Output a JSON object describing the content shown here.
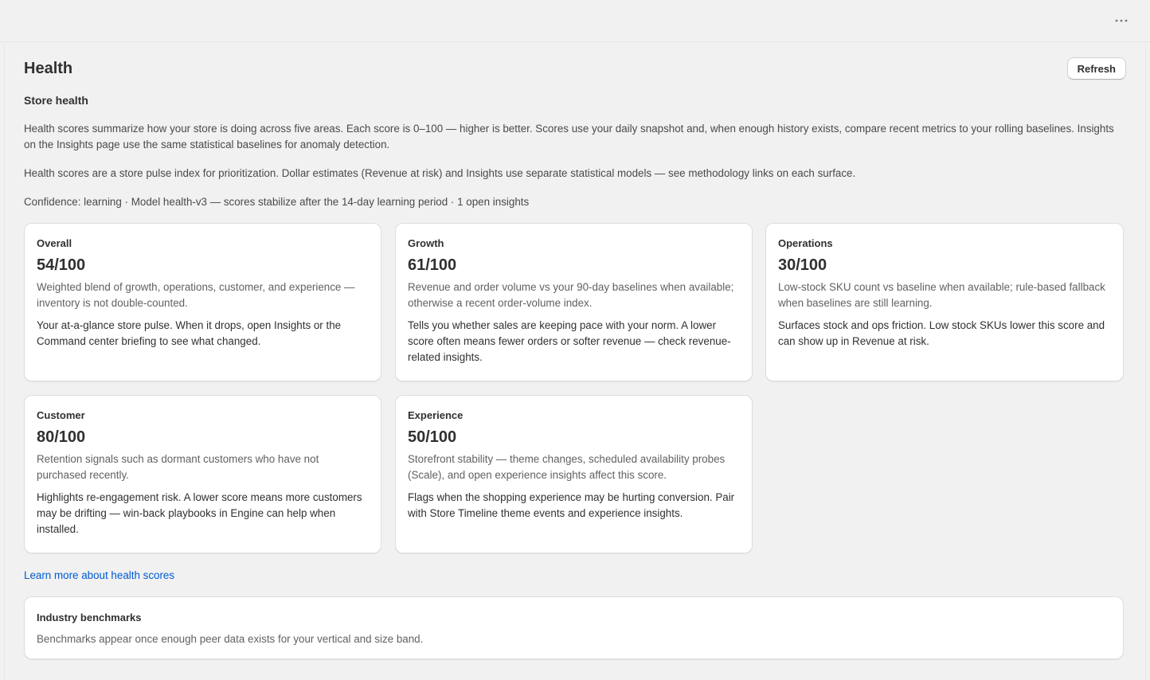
{
  "header": {
    "more_icon": "more-horizontal-icon"
  },
  "page": {
    "title": "Health",
    "refresh_label": "Refresh",
    "section_title": "Store health",
    "intro_1": "Health scores summarize how your store is doing across five areas. Each score is 0–100 — higher is better. Scores use your daily snapshot and, when enough history exists, compare recent metrics to your rolling baselines. Insights on the Insights page use the same statistical baselines for anomaly detection.",
    "intro_2": "Health scores are a store pulse index for prioritization. Dollar estimates (Revenue at risk) and Insights use separate statistical models — see methodology links on each surface.",
    "confidence_line": "Confidence: learning · Model health-v3 — scores stabilize after the 14-day learning period · 1 open insights"
  },
  "cards": [
    {
      "label": "Overall",
      "score": "54/100",
      "score_value": 54,
      "description": "Weighted blend of growth, operations, customer, and experience — inventory is not double-counted.",
      "note": "Your at-a-glance store pulse. When it drops, open Insights or the Command center briefing to see what changed."
    },
    {
      "label": "Growth",
      "score": "61/100",
      "score_value": 61,
      "description": "Revenue and order volume vs your 90-day baselines when available; otherwise a recent order-volume index.",
      "note": "Tells you whether sales are keeping pace with your norm. A lower score often means fewer orders or softer revenue — check revenue-related insights."
    },
    {
      "label": "Operations",
      "score": "30/100",
      "score_value": 30,
      "description": "Low-stock SKU count vs baseline when available; rule-based fallback when baselines are still learning.",
      "note": "Surfaces stock and ops friction. Low stock SKUs lower this score and can show up in Revenue at risk."
    },
    {
      "label": "Customer",
      "score": "80/100",
      "score_value": 80,
      "description": "Retention signals such as dormant customers who have not purchased recently.",
      "note": "Highlights re-engagement risk. A lower score means more customers may be drifting — win-back playbooks in Engine can help when installed."
    },
    {
      "label": "Experience",
      "score": "50/100",
      "score_value": 50,
      "description": "Storefront stability — theme changes, scheduled availability probes (Scale), and open experience insights affect this score.",
      "note": "Flags when the shopping experience may be hurting conversion. Pair with Store Timeline theme events and experience insights."
    }
  ],
  "learn_more_link": "Learn more about health scores",
  "benchmarks": {
    "title": "Industry benchmarks",
    "text": "Benchmarks appear once enough peer data exists for your vertical and size band."
  },
  "colors": {
    "page_bg": "#f1f1f1",
    "card_bg": "#ffffff",
    "text": "#303030",
    "muted_text": "#616161",
    "link": "#005bd3"
  }
}
